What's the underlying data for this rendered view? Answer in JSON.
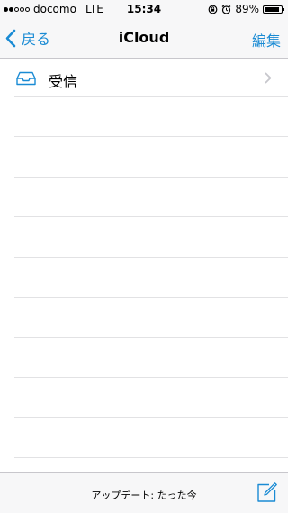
{
  "statusbar": {
    "carrier": "docomo",
    "network": "LTE",
    "time": "15:34",
    "battery": "89%",
    "battery_level": 0.89,
    "signal_bars": 2,
    "signal_total": 5
  },
  "navbar": {
    "back_label": "戻る",
    "title": "iCloud",
    "edit_label": "編集"
  },
  "mailboxes": [
    {
      "label": "受信",
      "icon": "inbox-icon"
    }
  ],
  "toolbar": {
    "status": "アップデート: たった今",
    "compose_icon": "compose-icon"
  },
  "colors": {
    "accent": "#1a8bd4",
    "bar_bg": "#f7f7f8",
    "separator": "#e2e2e4"
  }
}
